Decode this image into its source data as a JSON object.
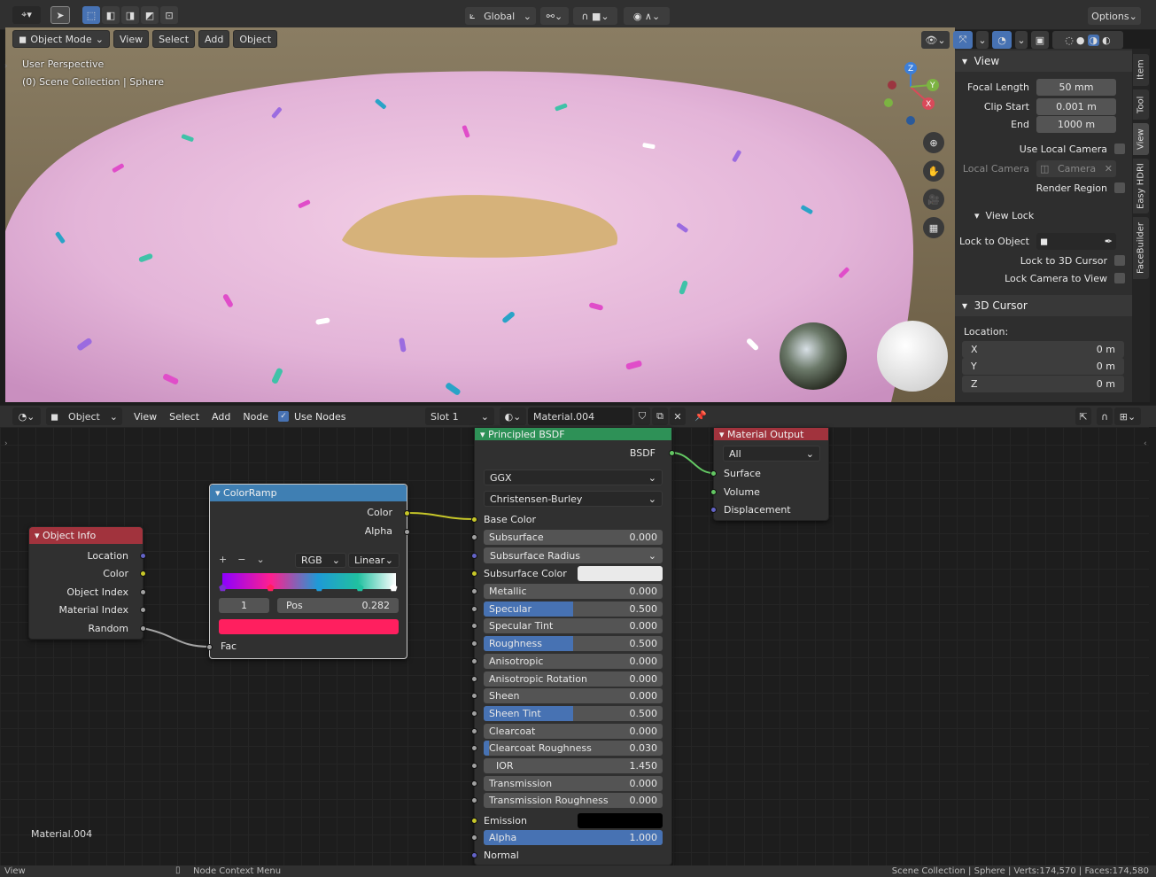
{
  "topbar": {
    "orientation": "Global",
    "options_label": "Options"
  },
  "viewport": {
    "mode_label": "Object Mode",
    "menu": [
      "View",
      "Select",
      "Add",
      "Object"
    ],
    "overlay_line1": "User Perspective",
    "overlay_line2": "(0) Scene Collection | Sphere"
  },
  "npanel": {
    "view_header": "View",
    "focal_length_label": "Focal Length",
    "focal_length_value": "50 mm",
    "clip_start_label": "Clip Start",
    "clip_start_value": "0.001 m",
    "end_label": "End",
    "end_value": "1000 m",
    "use_local_camera": "Use Local Camera",
    "local_camera_label": "Local Camera",
    "local_camera_value": "Camera",
    "render_region": "Render Region",
    "view_lock_header": "View Lock",
    "lock_to_object": "Lock to Object",
    "lock_to_3d_cursor": "Lock to 3D Cursor",
    "lock_camera_to_view": "Lock Camera to View",
    "cursor_header": "3D Cursor",
    "location_label": "Location:",
    "x_label": "X",
    "x_value": "0 m",
    "y_label": "Y",
    "y_value": "0 m",
    "z_label": "Z",
    "z_value": "0 m",
    "tabs": [
      "Item",
      "Tool",
      "View",
      "Easy HDRI",
      "FaceBuilder"
    ]
  },
  "nodehdr": {
    "type_label": "Object",
    "menu": [
      "View",
      "Select",
      "Add",
      "Node"
    ],
    "use_nodes": "Use Nodes",
    "slot": "Slot 1",
    "material": "Material.004"
  },
  "object_info": {
    "title": "Object Info",
    "outputs": [
      "Location",
      "Color",
      "Object Index",
      "Material Index",
      "Random"
    ]
  },
  "color_ramp": {
    "title": "ColorRamp",
    "out_color": "Color",
    "out_alpha": "Alpha",
    "mode": "RGB",
    "interp": "Linear",
    "index": "1",
    "pos_label": "Pos",
    "pos_value": "0.282",
    "input_fac": "Fac",
    "swatch_color": "#ff1f5f"
  },
  "bsdf": {
    "title": "Principled BSDF",
    "output": "BSDF",
    "distribution": "GGX",
    "subsurface_method": "Christensen-Burley",
    "base_color": "Base Color",
    "subsurface": {
      "label": "Subsurface",
      "value": "0.000"
    },
    "subsurface_radius": "Subsurface Radius",
    "subsurface_color": "Subsurface Color",
    "fields": [
      {
        "label": "Metallic",
        "value": "0.000",
        "fill": 0
      },
      {
        "label": "Specular",
        "value": "0.500",
        "fill": 0.5
      },
      {
        "label": "Specular Tint",
        "value": "0.000",
        "fill": 0
      },
      {
        "label": "Roughness",
        "value": "0.500",
        "fill": 0.5
      },
      {
        "label": "Anisotropic",
        "value": "0.000",
        "fill": 0
      },
      {
        "label": "Anisotropic Rotation",
        "value": "0.000",
        "fill": 0
      },
      {
        "label": "Sheen",
        "value": "0.000",
        "fill": 0
      },
      {
        "label": "Sheen Tint",
        "value": "0.500",
        "fill": 0.5
      },
      {
        "label": "Clearcoat",
        "value": "0.000",
        "fill": 0
      },
      {
        "label": "Clearcoat Roughness",
        "value": "0.030",
        "fill": 0.03
      },
      {
        "label": "IOR",
        "value": "1.450",
        "fill": 0
      },
      {
        "label": "Transmission",
        "value": "0.000",
        "fill": 0
      },
      {
        "label": "Transmission Roughness",
        "value": "0.000",
        "fill": 0
      }
    ],
    "emission": "Emission",
    "alpha": {
      "label": "Alpha",
      "value": "1.000",
      "fill": 1
    },
    "normal": "Normal"
  },
  "output_node": {
    "title": "Material Output",
    "target": "All",
    "inputs": [
      "Surface",
      "Volume",
      "Displacement"
    ]
  },
  "node_tree_label": "Material.004",
  "status": {
    "left": "View",
    "middle": "Node Context Menu",
    "right": "Scene Collection | Sphere | Verts:174,570 | Faces:174,580"
  }
}
